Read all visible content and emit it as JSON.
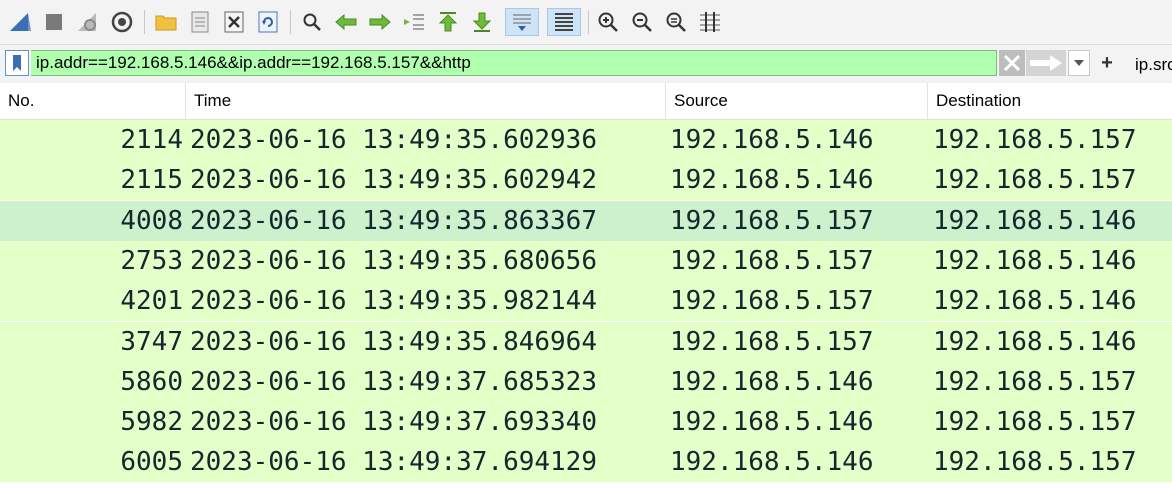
{
  "toolbar": {
    "icons": [
      "shark-fin-start-icon",
      "stop-capture-icon",
      "restart-capture-icon",
      "capture-options-icon",
      "open-file-icon",
      "save-file-icon",
      "close-file-icon",
      "reload-file-icon",
      "find-packet-icon",
      "go-back-icon",
      "go-forward-icon",
      "go-to-packet-icon",
      "go-first-icon",
      "go-last-icon",
      "auto-scroll-icon",
      "colorize-icon",
      "zoom-in-icon",
      "zoom-out-icon",
      "normal-size-icon",
      "resize-columns-icon"
    ]
  },
  "filter": {
    "value": "ip.addr==192.168.5.146&&ip.addr==192.168.5.157&&http",
    "expression_label": "ip.src",
    "background": "#afffaf"
  },
  "packet_list": {
    "columns": [
      "No.",
      "Time",
      "Source",
      "Destination"
    ],
    "selected_index": 2,
    "row_color": "#e4ffc7",
    "selected_color": "#cdf0cd",
    "rows": [
      {
        "no": "2114",
        "time": "2023-06-16 13:49:35.602936",
        "source": "192.168.5.146",
        "destination": "192.168.5.157"
      },
      {
        "no": "2115",
        "time": "2023-06-16 13:49:35.602942",
        "source": "192.168.5.146",
        "destination": "192.168.5.157"
      },
      {
        "no": "4008",
        "time": "2023-06-16 13:49:35.863367",
        "source": "192.168.5.157",
        "destination": "192.168.5.146"
      },
      {
        "no": "2753",
        "time": "2023-06-16 13:49:35.680656",
        "source": "192.168.5.157",
        "destination": "192.168.5.146"
      },
      {
        "no": "4201",
        "time": "2023-06-16 13:49:35.982144",
        "source": "192.168.5.157",
        "destination": "192.168.5.146"
      },
      {
        "no": "3747",
        "time": "2023-06-16 13:49:35.846964",
        "source": "192.168.5.157",
        "destination": "192.168.5.146"
      },
      {
        "no": "5860",
        "time": "2023-06-16 13:49:37.685323",
        "source": "192.168.5.146",
        "destination": "192.168.5.157"
      },
      {
        "no": "5982",
        "time": "2023-06-16 13:49:37.693340",
        "source": "192.168.5.146",
        "destination": "192.168.5.157"
      },
      {
        "no": "6005",
        "time": "2023-06-16 13:49:37.694129",
        "source": "192.168.5.146",
        "destination": "192.168.5.157"
      }
    ]
  }
}
